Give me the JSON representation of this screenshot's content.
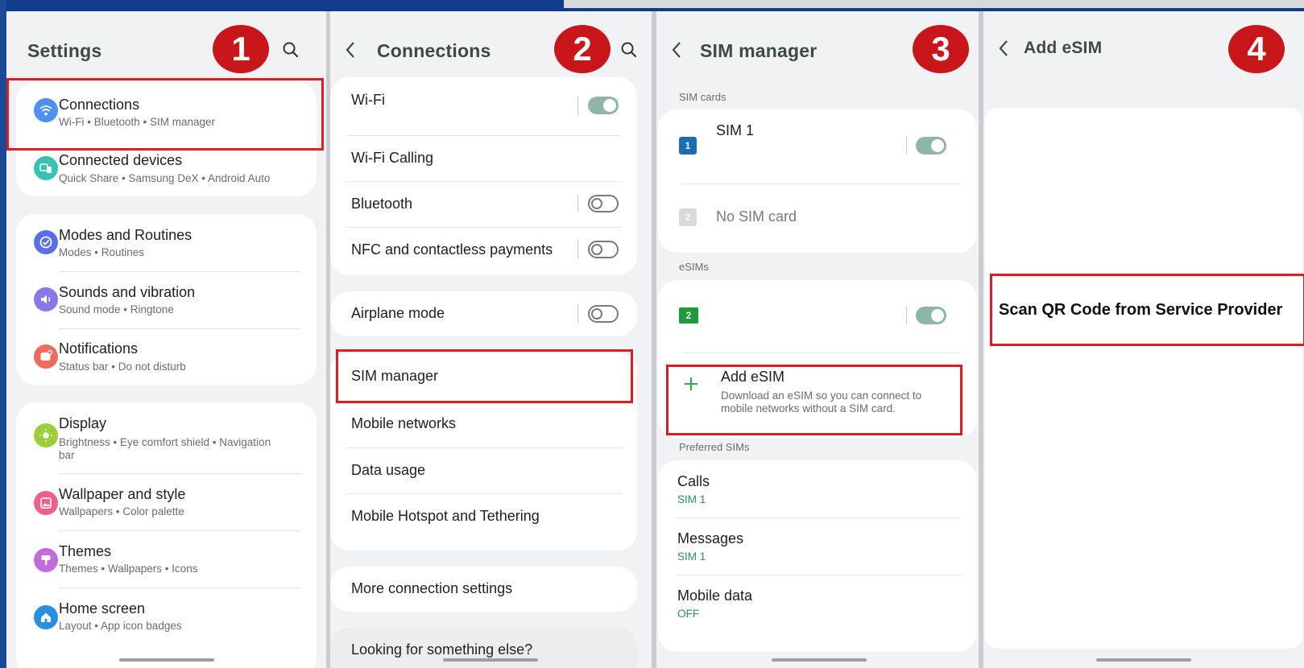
{
  "colors": {
    "accent_toggle": "#8fb5a8",
    "highlight_box": "#e01b24",
    "step_badge": "#c8161a",
    "add_plus": "#2fa84f"
  },
  "steps": [
    "1",
    "2",
    "3",
    "4"
  ],
  "settings": {
    "title": "Settings",
    "items": [
      {
        "label": "Connections",
        "sub": "Wi-Fi  •  Bluetooth  •  SIM manager",
        "icon": "wifi-icon"
      },
      {
        "label": "Connected devices",
        "sub": "Quick Share  •  Samsung DeX  •  Android Auto",
        "icon": "connected-devices-icon"
      },
      {
        "label": "Modes and Routines",
        "sub": "Modes  •  Routines",
        "icon": "modes-routines-icon"
      },
      {
        "label": "Sounds and vibration",
        "sub": "Sound mode  •  Ringtone",
        "icon": "speaker-icon"
      },
      {
        "label": "Notifications",
        "sub": "Status bar  •  Do not disturb",
        "icon": "notification-icon"
      },
      {
        "label": "Display",
        "sub": "Brightness  •  Eye comfort shield  •  Navigation",
        "sub2": "bar",
        "icon": "sun-icon"
      },
      {
        "label": "Wallpaper and style",
        "sub": "Wallpapers  •  Color palette",
        "icon": "wallpaper-icon"
      },
      {
        "label": "Themes",
        "sub": "Themes  •  Wallpapers  •  Icons",
        "icon": "themes-icon"
      },
      {
        "label": "Home screen",
        "sub": "Layout  •  App icon badges",
        "icon": "home-icon"
      }
    ]
  },
  "connections": {
    "title": "Connections",
    "items": [
      {
        "label": "Wi-Fi",
        "toggle": "on"
      },
      {
        "label": "Wi-Fi Calling"
      },
      {
        "label": "Bluetooth",
        "toggle": "off"
      },
      {
        "label": "NFC and contactless payments",
        "toggle": "off"
      },
      {
        "label": "Airplane mode",
        "toggle": "off"
      },
      {
        "label": "SIM manager"
      },
      {
        "label": "Mobile networks"
      },
      {
        "label": "Data usage"
      },
      {
        "label": "Mobile Hotspot and Tethering"
      },
      {
        "label": "More connection settings"
      },
      {
        "label": "Looking for something else?"
      }
    ]
  },
  "sim_manager": {
    "title": "SIM manager",
    "sim_cards_label": "SIM cards",
    "sim1": {
      "label": "SIM 1",
      "badge": "1",
      "toggle": "on"
    },
    "sim2": {
      "label": "No SIM card",
      "badge": "2"
    },
    "esims_label": "eSIMs",
    "esim": {
      "badge": "2",
      "toggle": "on"
    },
    "add_esim": {
      "label": "Add eSIM",
      "desc1": "Download an eSIM so you can connect to",
      "desc2": "mobile networks without a SIM card.",
      "icon": "plus-icon"
    },
    "preferred_label": "Preferred SIMs",
    "preferred": [
      {
        "label": "Calls",
        "value": "SIM 1"
      },
      {
        "label": "Messages",
        "value": "SIM 1"
      },
      {
        "label": "Mobile data",
        "value": "OFF"
      }
    ]
  },
  "add_esim": {
    "title": "Add eSIM",
    "scan_text": "Scan QR Code from Service Provider"
  }
}
